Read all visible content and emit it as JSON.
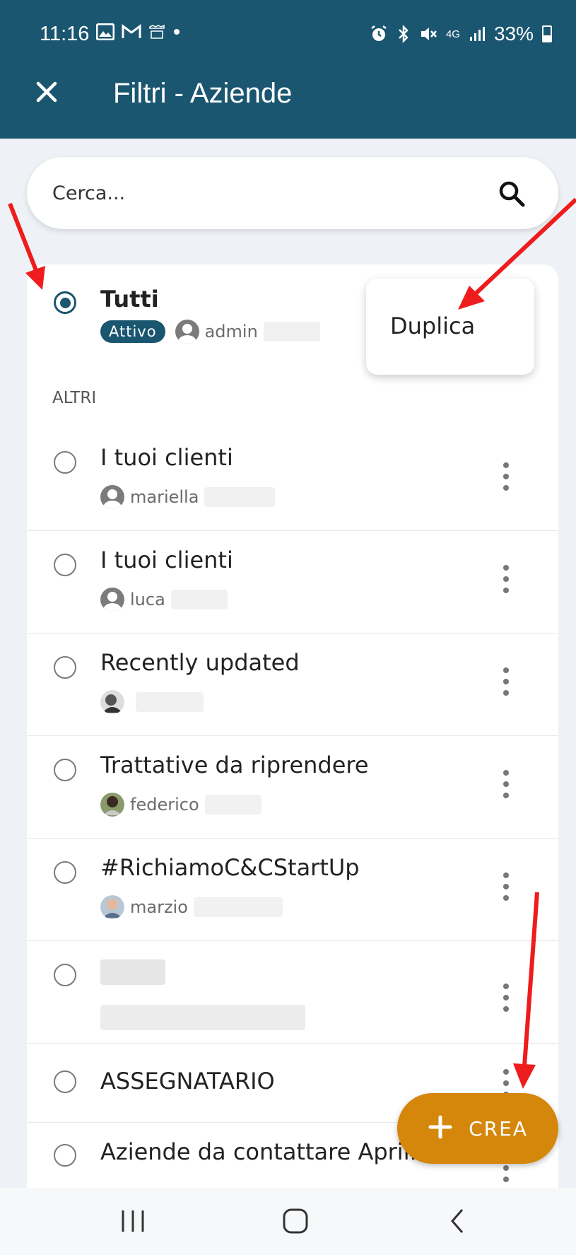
{
  "status_bar": {
    "time": "11:16",
    "network": "4G",
    "battery": "33%"
  },
  "appbar": {
    "title": "Filtri - Aziende"
  },
  "search": {
    "placeholder": "Cerca..."
  },
  "active_filter": {
    "title": "Tutti",
    "badge": "Attivo",
    "owner": "admin"
  },
  "context_menu": {
    "items": [
      "Duplica"
    ]
  },
  "section_label": "ALTRI",
  "filters": [
    {
      "title": "I tuoi clienti",
      "owner": "mariella"
    },
    {
      "title": "I tuoi clienti",
      "owner": "luca"
    },
    {
      "title": "Recently updated",
      "owner": ""
    },
    {
      "title": "Trattative da riprendere",
      "owner": "federico"
    },
    {
      "title": "#RichiamoC&CStartUp",
      "owner": "marzio"
    },
    {
      "title": "",
      "owner": ""
    },
    {
      "title": "ASSEGNATARIO",
      "owner": ""
    },
    {
      "title": "Aziende da contattare April...",
      "owner": ""
    }
  ],
  "fab": {
    "label": "CREA"
  },
  "colors": {
    "primary": "#1b5670",
    "accent": "#d4870a",
    "annotation_arrow": "#ee1c1c"
  }
}
